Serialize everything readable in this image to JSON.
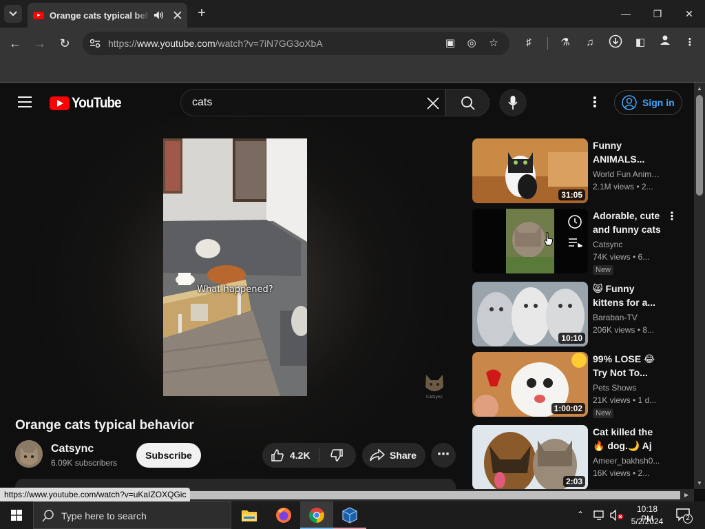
{
  "browser": {
    "tab_title": "Orange cats typical behavior",
    "url_prefix": "https://",
    "url_host": "www.youtube.com",
    "url_path": "/watch?v=7iN7GG3oXbA",
    "status_url": "https://www.youtube.com/watch?v=uKaIZOXQGic"
  },
  "youtube": {
    "logo_text": "YouTube",
    "search_value": "cats",
    "signin_label": "Sign in"
  },
  "video": {
    "caption": "What happened?",
    "title": "Orange cats typical behavior",
    "channel_name": "Catsync",
    "channel_subs": "6.09K subscribers",
    "subscribe_label": "Subscribe",
    "like_count": "4.2K",
    "share_label": "Share"
  },
  "related": [
    {
      "title": "Funny ANIMALS...",
      "channel": "World Fun Anima...",
      "meta": "2.1M views  • 2...",
      "duration": "31:05",
      "new": ""
    },
    {
      "title": "Adorable, cute and funny cats",
      "channel": "Catsync",
      "meta": "74K views  • 6...",
      "duration": "",
      "new": "New"
    },
    {
      "title": "😸 Funny kittens for a...",
      "channel": "Baraban-TV",
      "meta": "206K views  • 8...",
      "duration": "10:10",
      "new": ""
    },
    {
      "title": "99% LOSE 😂 Try Not To...",
      "channel": "Pets Shows",
      "meta": "21K views  • 1 d...",
      "duration": "1:00:02",
      "new": "New"
    },
    {
      "title": "Cat killed the🔥 dog.🌙 Aj is...",
      "channel": "Ameer_bakhsh0...",
      "meta": "16K views  • 2...",
      "duration": "2:03",
      "new": ""
    }
  ],
  "taskbar": {
    "search_placeholder": "Type here to search",
    "time": "10:18 PM",
    "date": "5/2/2024",
    "notifications": "2"
  }
}
